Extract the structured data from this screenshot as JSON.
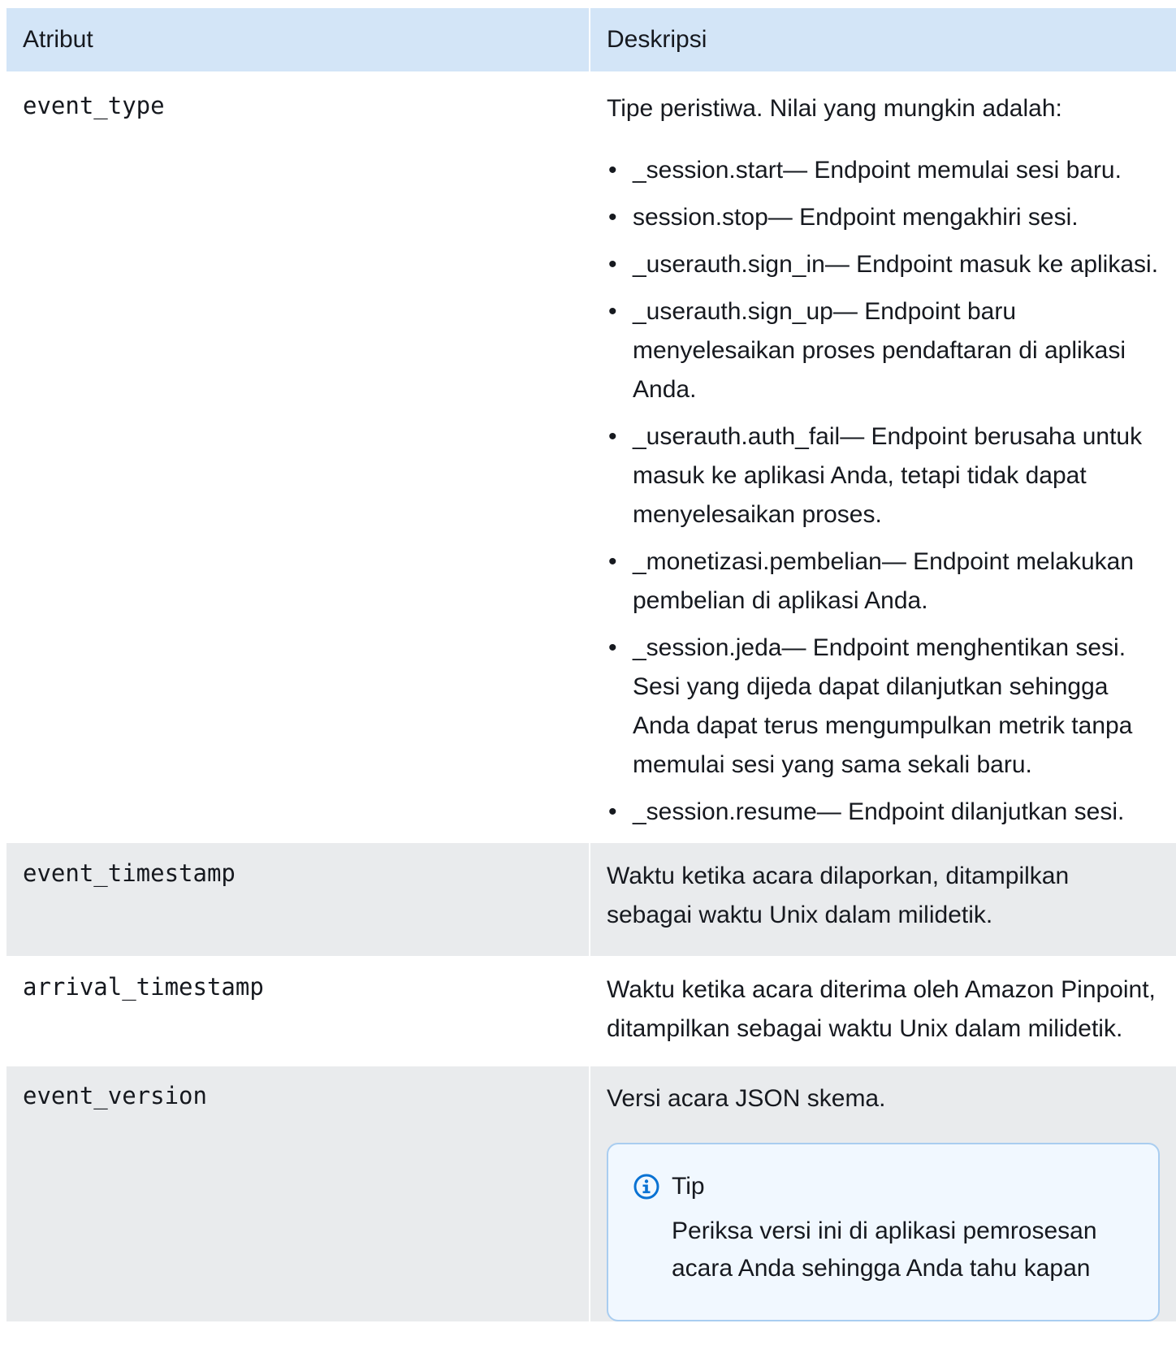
{
  "table": {
    "headers": {
      "attribute": "Atribut",
      "description": "Deskripsi"
    },
    "event_type": {
      "name": "event_type",
      "intro": "Tipe peristiwa. Nilai yang mungkin adalah:",
      "values": [
        "_session.start— Endpoint memulai sesi baru.",
        "session.stop— Endpoint mengakhiri sesi.",
        "_userauth.sign_in— Endpoint masuk ke aplikasi.",
        "_userauth.sign_up— Endpoint baru menyelesaikan proses pendaftaran di aplikasi Anda.",
        "_userauth.auth_fail— Endpoint berusaha untuk masuk ke aplikasi Anda, tetapi tidak dapat menyelesaikan proses.",
        "_monetizasi.pembelian— Endpoint melakukan pembelian di aplikasi Anda.",
        "_session.jeda— Endpoint menghentikan sesi. Sesi yang dijeda dapat dilanjutkan sehingga Anda dapat terus mengumpulkan metrik tanpa memulai sesi yang sama sekali baru.",
        "_session.resume— Endpoint dilanjutkan sesi."
      ]
    },
    "event_timestamp": {
      "name": "event_timestamp",
      "description": "Waktu ketika acara dilaporkan, ditampilkan sebagai waktu Unix dalam milidetik."
    },
    "arrival_timestamp": {
      "name": "arrival_timestamp",
      "description": "Waktu ketika acara diterima oleh Amazon Pinpoint, ditampilkan sebagai waktu Unix dalam milidetik."
    },
    "event_version": {
      "name": "event_version",
      "description": "Versi acara JSON skema.",
      "tip": {
        "title": "Tip",
        "body": "Periksa versi ini di aplikasi pemrosesan acara Anda sehingga Anda tahu kapan"
      }
    }
  },
  "colors": {
    "header_bg": "#d3e5f7",
    "alt_row_bg": "#e9ebed",
    "tip_border": "#a9cdf0",
    "tip_bg": "#f1f8ff",
    "info_icon": "#0972d3"
  }
}
